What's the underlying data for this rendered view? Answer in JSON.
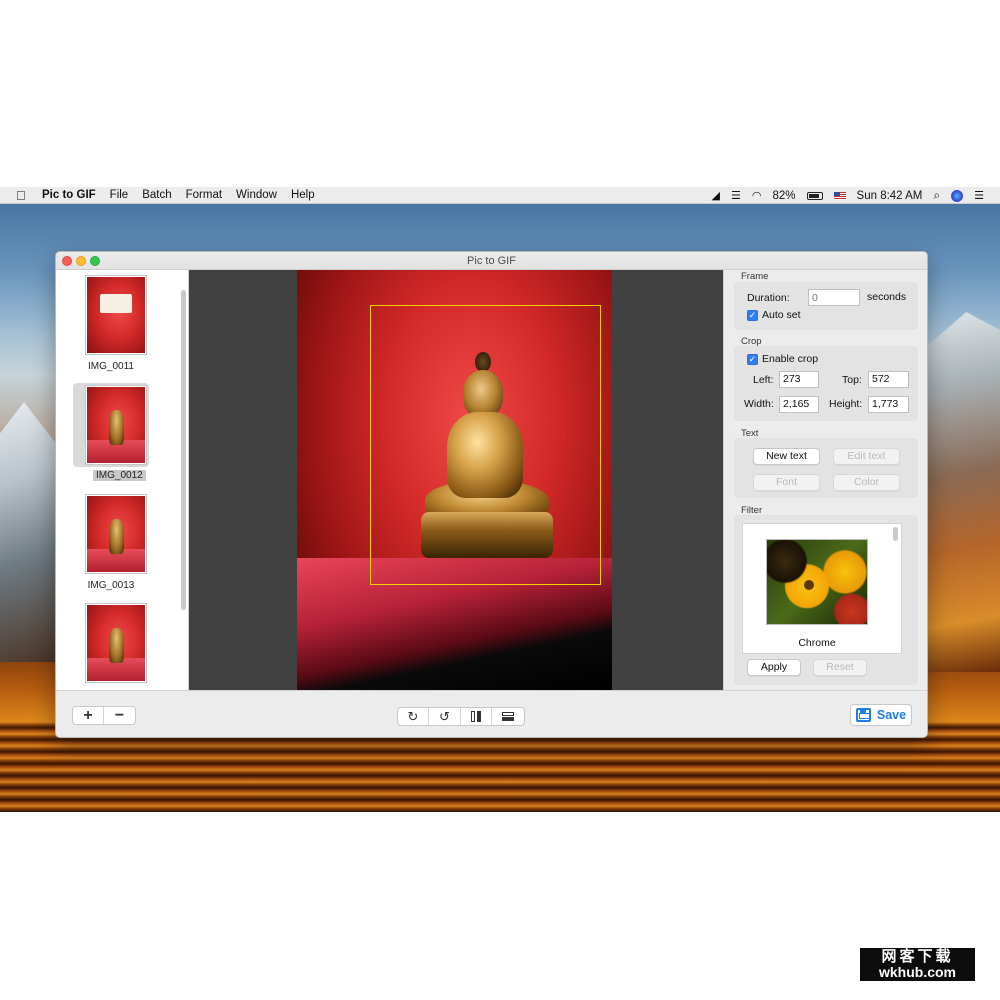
{
  "menubar": {
    "app_name": "Pic to GIF",
    "menus": [
      "File",
      "Batch",
      "Format",
      "Window",
      "Help"
    ],
    "battery": "82%",
    "clock": "Sun 8:42 AM",
    "status_icons": [
      "airplay-icon",
      "bars-icon",
      "wifi-icon",
      "battery-icon",
      "flag-icon",
      "search-icon",
      "siri-icon",
      "menu-list-icon"
    ]
  },
  "window": {
    "title": "Pic to GIF"
  },
  "sidebar": {
    "items": [
      {
        "label": "IMG_0011",
        "selected": false
      },
      {
        "label": "IMG_0012",
        "selected": true
      },
      {
        "label": "IMG_0013",
        "selected": false
      },
      {
        "label": "",
        "selected": false
      }
    ]
  },
  "frame": {
    "title": "Frame",
    "duration_label": "Duration:",
    "duration_placeholder": "0",
    "seconds_label": "seconds",
    "auto_set_label": "Auto set",
    "auto_set_checked": true
  },
  "crop": {
    "title": "Crop",
    "enable_label": "Enable crop",
    "enabled": true,
    "left_label": "Left:",
    "left_value": "273",
    "top_label": "Top:",
    "top_value": "572",
    "width_label": "Width:",
    "width_value": "2,165",
    "height_label": "Height:",
    "height_value": "1,773"
  },
  "text_section": {
    "title": "Text",
    "new_text": "New text",
    "edit_text": "Edit text",
    "font": "Font",
    "color": "Color"
  },
  "filter": {
    "title": "Filter",
    "preset_name": "Chrome",
    "apply": "Apply",
    "reset": "Reset"
  },
  "toolbar": {
    "add": "+",
    "remove": "−",
    "rotate_cw": "↻",
    "rotate_ccw": "↺",
    "save": "Save"
  },
  "watermark": {
    "line1": "网客下载",
    "line2": "wkhub.com"
  },
  "colors": {
    "accent": "#1f7de8",
    "crop_border": "#f6d200",
    "close": "#fc5f57",
    "minimize": "#fdbc2e",
    "maximize": "#33c748"
  }
}
